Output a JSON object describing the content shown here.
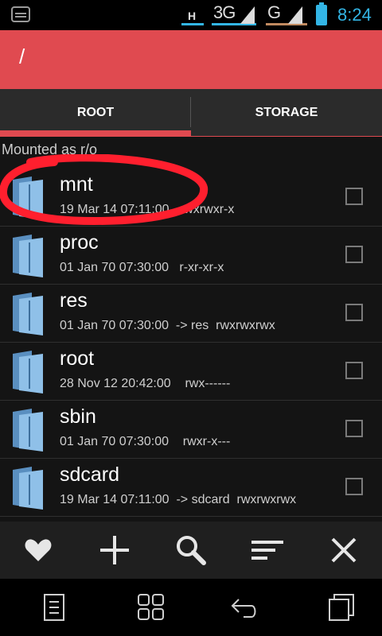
{
  "status_bar": {
    "network_h": "H",
    "network_3g": "3G",
    "network_g": "G",
    "time": "8:24",
    "icons": [
      "bbm-icon",
      "signal-1-icon",
      "signal-2-icon",
      "battery-icon"
    ]
  },
  "header": {
    "path": "/"
  },
  "tabs": [
    {
      "label": "ROOT",
      "active": true
    },
    {
      "label": "STORAGE",
      "active": false
    }
  ],
  "mount_status": "Mounted as r/o",
  "files": [
    {
      "name": "mnt",
      "date": "19 Mar 14 07:11:00",
      "link": "",
      "perms": "rwxrwxr-x"
    },
    {
      "name": "proc",
      "date": "01 Jan 70 07:30:00",
      "link": "",
      "perms": "r-xr-xr-x"
    },
    {
      "name": "res",
      "date": "01 Jan 70 07:30:00",
      "link": "-> res",
      "perms": "rwxrwxrwx"
    },
    {
      "name": "root",
      "date": "28 Nov 12 20:42:00",
      "link": "",
      "perms": "rwx------"
    },
    {
      "name": "sbin",
      "date": "01 Jan 70 07:30:00",
      "link": "",
      "perms": "rwxr-x---"
    },
    {
      "name": "sdcard",
      "date": "19 Mar 14 07:11:00",
      "link": "-> sdcard",
      "perms": "rwxrwxrwx"
    }
  ],
  "actions": [
    "favorite-icon",
    "add-icon",
    "search-icon",
    "sort-icon",
    "close-icon"
  ],
  "nav": [
    "menu-icon",
    "apps-icon",
    "back-icon",
    "recent-apps-icon"
  ],
  "colors": {
    "accent": "#e04a50",
    "status_accent": "#33b5e5"
  }
}
